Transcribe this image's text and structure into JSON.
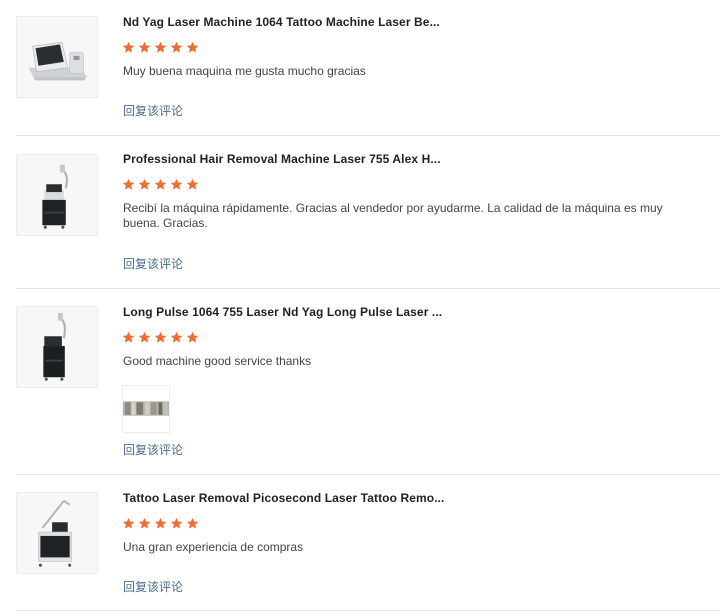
{
  "colors": {
    "star": "#f06d2b",
    "reply_link": "#4a6c8c",
    "divider": "#e2e2e2"
  },
  "reviews": [
    {
      "title": "Nd Yag Laser Machine 1064 Tattoo Machine Laser Be...",
      "rating": 5,
      "comment": "Muy buena maquina me gusta mucho gracias",
      "reply_label": "回复该评论",
      "product_icon": "tabletop-laser-machine-icon"
    },
    {
      "title": "Professional Hair Removal Machine Laser 755 Alex H...",
      "rating": 5,
      "comment": "Recibí la máquina rápidamente. Gracias al vendedor por ayudarme. La calidad de la máquina es muy buena. Gracias.",
      "reply_label": "回复该评论",
      "product_icon": "tower-laser-machine-icon"
    },
    {
      "title": "Long Pulse 1064 755 Laser Nd Yag Long Pulse Laser ...",
      "rating": 5,
      "comment": "Good machine good service thanks",
      "reply_label": "回复该评论",
      "product_icon": "tower-laser-machine-icon",
      "has_photo": true
    },
    {
      "title": "Tattoo Laser Removal Picosecond Laser Tattoo Remo...",
      "rating": 5,
      "comment": "Una gran experiencia de compras",
      "reply_label": "回复该评论",
      "product_icon": "arm-laser-machine-icon"
    }
  ]
}
